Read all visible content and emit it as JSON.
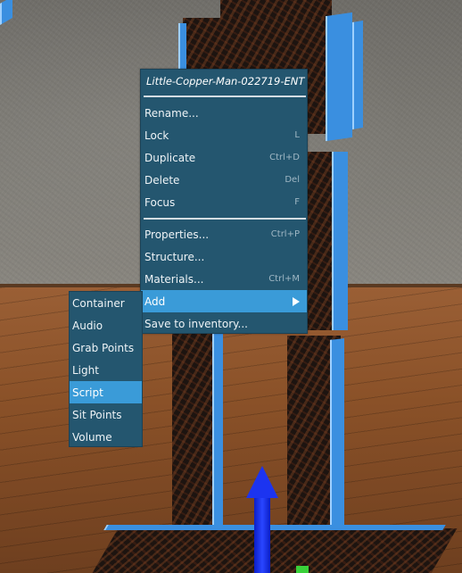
{
  "context_menu": {
    "title": "Little-Copper-Man-022719-ENT",
    "groups": [
      [
        {
          "label": "Rename...",
          "shortcut": ""
        },
        {
          "label": "Lock",
          "shortcut": "L"
        },
        {
          "label": "Duplicate",
          "shortcut": "Ctrl+D"
        },
        {
          "label": "Delete",
          "shortcut": "Del"
        },
        {
          "label": "Focus",
          "shortcut": "F"
        }
      ],
      [
        {
          "label": "Properties...",
          "shortcut": "Ctrl+P"
        },
        {
          "label": "Structure...",
          "shortcut": ""
        },
        {
          "label": "Materials...",
          "shortcut": "Ctrl+M"
        },
        {
          "label": "Add",
          "shortcut": "",
          "has_submenu": true,
          "highlighted": true
        },
        {
          "label": "Save to inventory...",
          "shortcut": ""
        }
      ]
    ]
  },
  "add_submenu": {
    "items": [
      {
        "label": "Container"
      },
      {
        "label": "Audio"
      },
      {
        "label": "Grab Points"
      },
      {
        "label": "Light"
      },
      {
        "label": "Script",
        "highlighted": true
      },
      {
        "label": "Sit Points"
      },
      {
        "label": "Volume"
      }
    ]
  },
  "colors": {
    "menu_bg": "#24566f",
    "highlight": "#3a9bd8",
    "selection_outline": "#3a8fe0"
  }
}
